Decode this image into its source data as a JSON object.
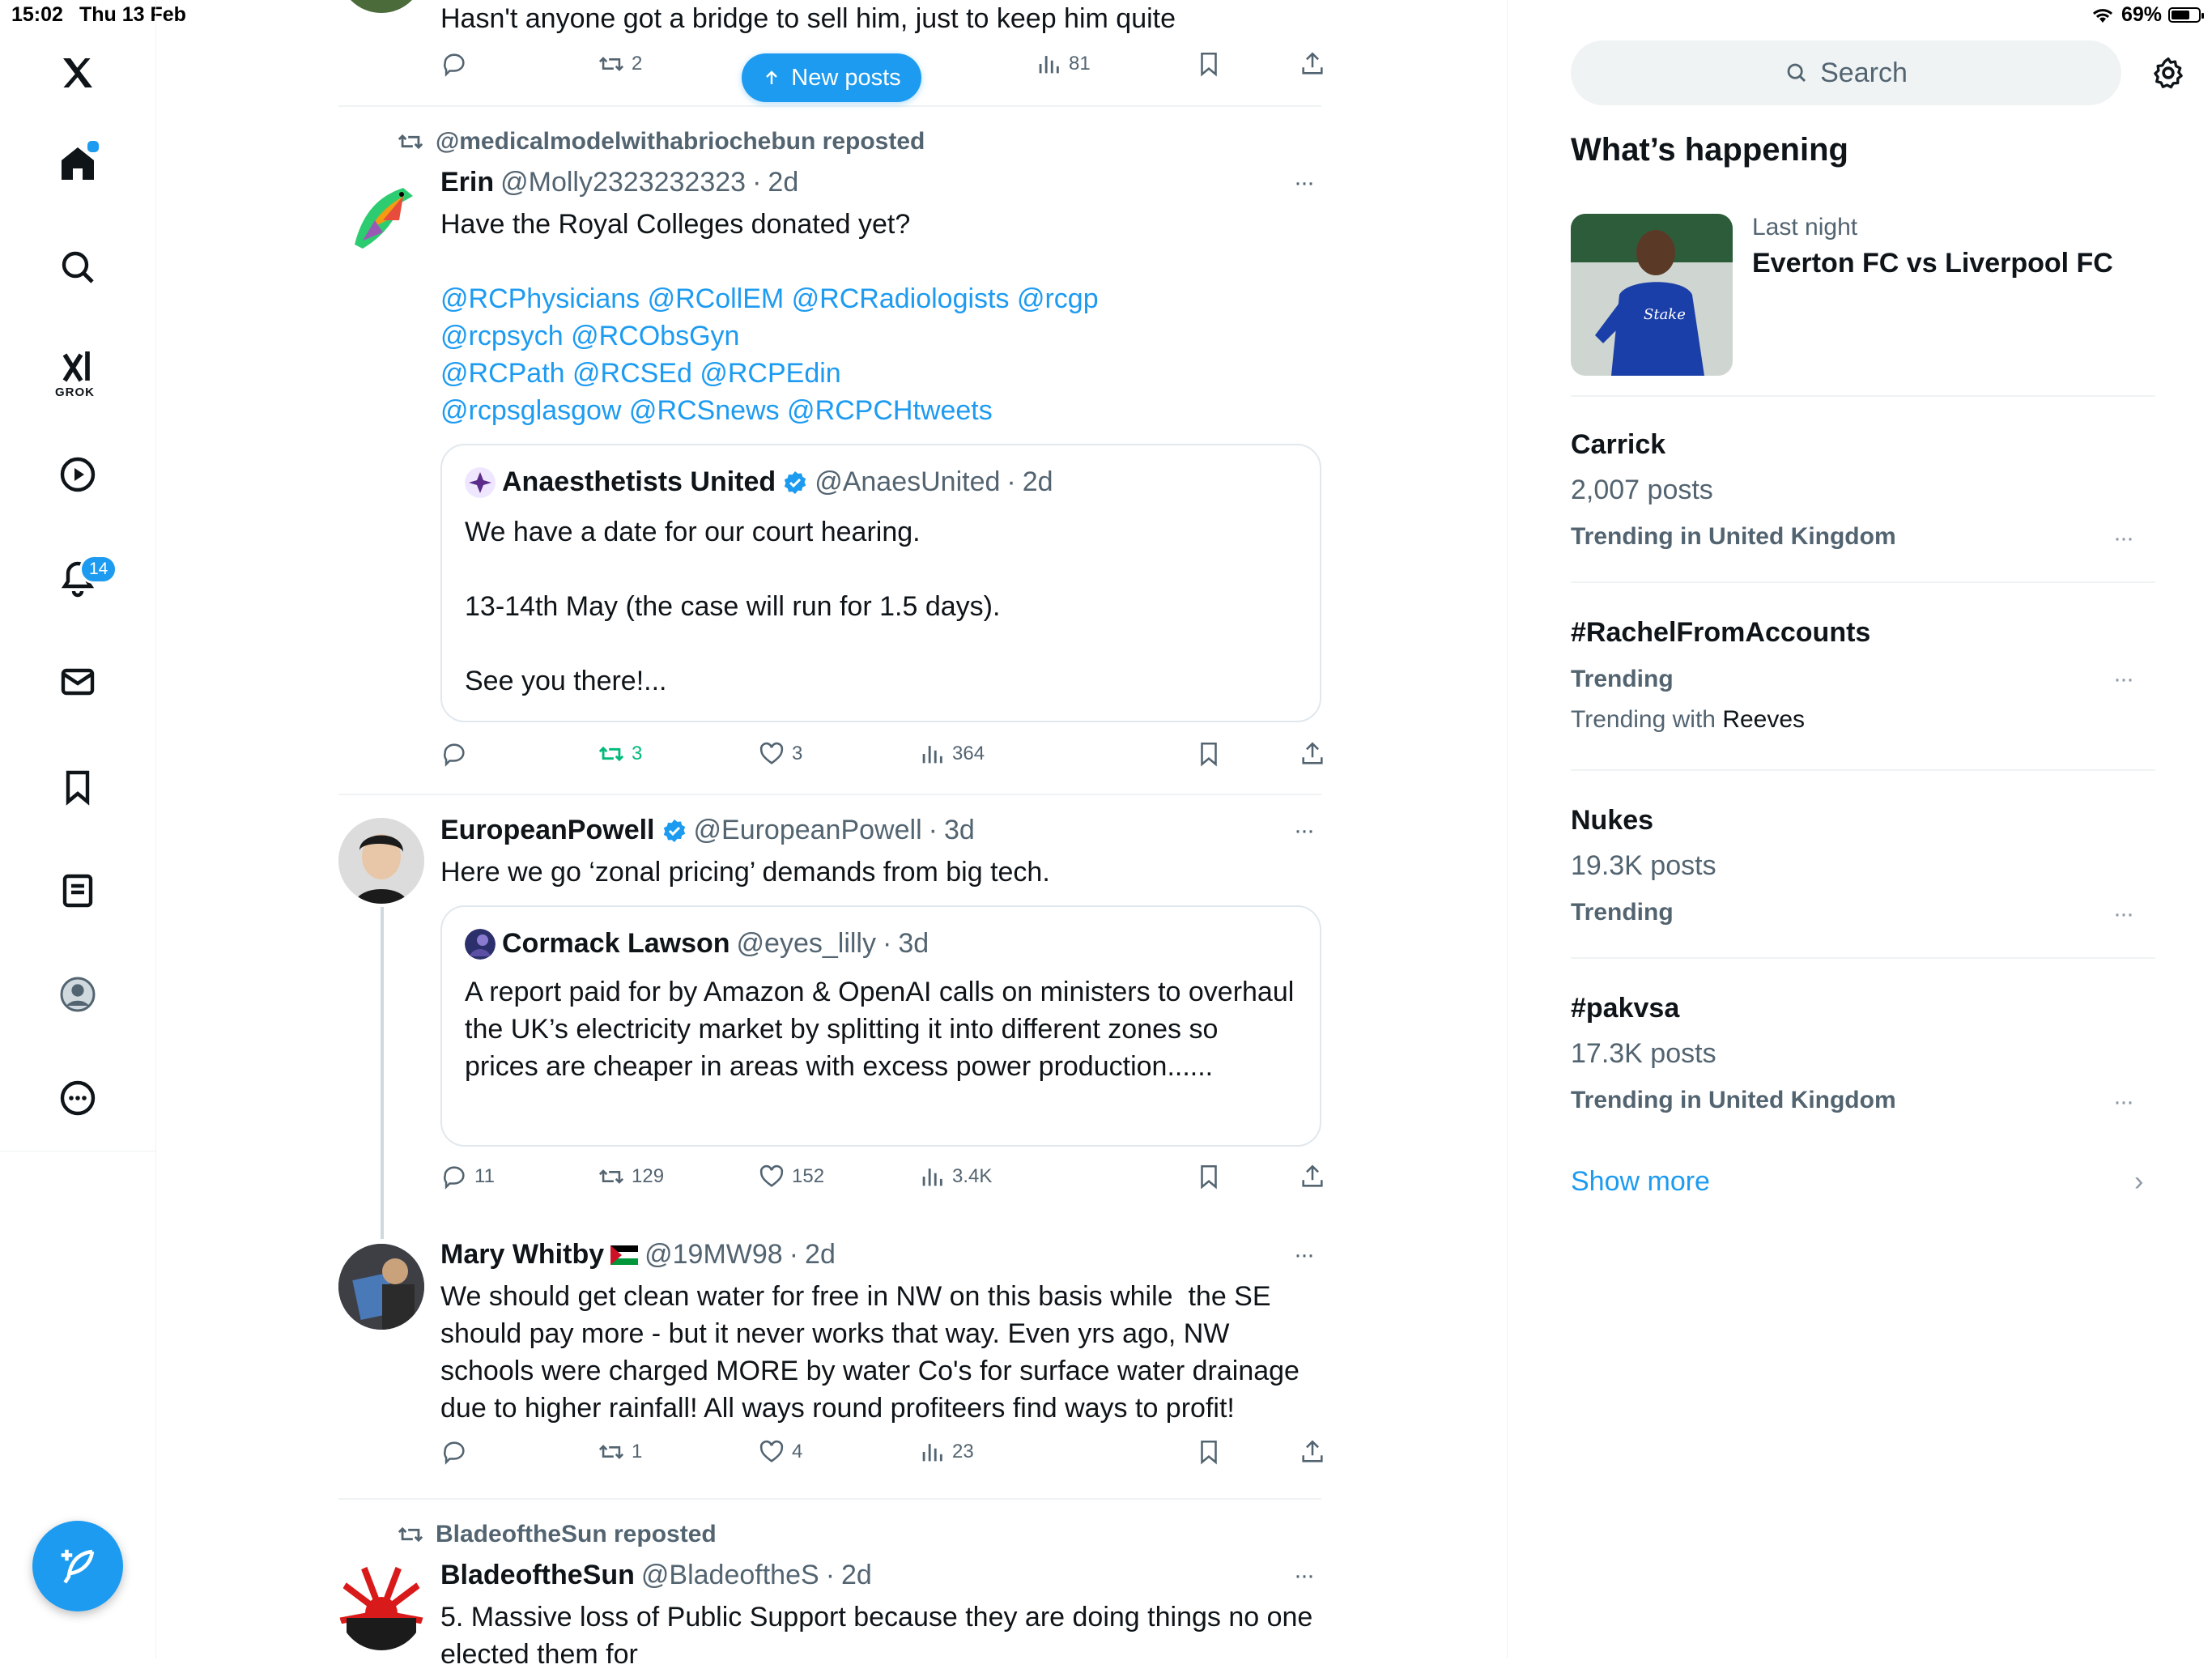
{
  "status": {
    "time": "15:02",
    "date": "Thu 13 Feb",
    "battery": "69%",
    "battery_level": 0.69
  },
  "nav": {
    "notifications_badge": "14",
    "grok_label": "GROK",
    "items": [
      "x-logo",
      "home-icon",
      "search-icon",
      "grok-icon",
      "video-icon",
      "bell-icon",
      "mail-icon",
      "bookmark-icon",
      "lists-icon",
      "profile-icon",
      "more-icon"
    ]
  },
  "new_posts_label": "New posts",
  "feed": {
    "top_post": {
      "text": "Hasn't anyone got a bridge to sell him, just to keep him quite",
      "retweets": "2",
      "views": "81"
    },
    "post1": {
      "repost_by": "@medicalmodelwithabriochebun reposted",
      "name": "Erin",
      "handle": "@Molly2323232323",
      "time": "2d",
      "text": "Have the Royal Colleges donated yet?",
      "mentions": [
        "@RCPhysicians @RCollEM @RCRadiologists @rcgp",
        "@rcpsych @RCObsGyn",
        "@RCPath @RCSEd @RCPEdin",
        "@rcpsglasgow @RCSnews @RCPCHtweets"
      ],
      "quote": {
        "name": "Anaesthetists United",
        "handle": "@AnaesUnited",
        "time": "2d",
        "text": "We have a date for our court hearing.\n\n13-14th May (the case will run for 1.5 days).\n\nSee you there!..."
      },
      "retweets": "3",
      "likes": "3",
      "views": "364"
    },
    "post2": {
      "name": "EuropeanPowell",
      "handle": "@EuropeanPowell",
      "time": "3d",
      "text": "Here we go ‘zonal pricing’ demands from big tech.",
      "quote": {
        "name": "Cormack Lawson",
        "handle": "@eyes_lilly",
        "time": "3d",
        "text": "A report paid for by Amazon & OpenAI calls on ministers to overhaul the UK’s electricity market by splitting it into different zones so prices are cheaper in areas with excess power production......"
      },
      "replies": "11",
      "retweets": "129",
      "likes": "152",
      "views": "3.4K"
    },
    "post3": {
      "name": "Mary Whitby",
      "handle": "@19MW98",
      "time": "2d",
      "text": "We should get clean water for free in NW on this basis while  the SE should pay more - but it never works that way. Even yrs ago, NW schools were charged MORE by water Co's for surface water drainage due to higher rainfall! All ways round profiteers find ways to profit!",
      "retweets": "1",
      "likes": "4",
      "views": "23"
    },
    "post4": {
      "repost_by": "BladeoftheSun reposted",
      "name": "BladeoftheSun",
      "handle": "@BladeoftheS",
      "time": "2d",
      "text": "5. Massive loss of Public Support because they are doing things no one elected them for"
    }
  },
  "sidebar": {
    "search_placeholder": "Search",
    "heading": "What’s happening",
    "event": {
      "subtitle": "Last night",
      "title": "Everton FC vs Liverpool FC"
    },
    "trends": [
      {
        "title": "Carrick",
        "count": "2,007 posts",
        "meta": "Trending in United Kingdom"
      },
      {
        "title": "#RachelFromAccounts",
        "meta": "Trending",
        "with_prefix": "Trending with",
        "with_name": "Reeves"
      },
      {
        "title": "Nukes",
        "count": "19.3K posts",
        "meta": "Trending"
      },
      {
        "title": "#pakvsa",
        "count": "17.3K posts",
        "meta": "Trending in United Kingdom"
      }
    ],
    "show_more": "Show more"
  },
  "colors": {
    "accent": "#1d9bf0",
    "text": "#0f1419",
    "muted": "#536471",
    "retweet_green": "#00ba7c"
  }
}
